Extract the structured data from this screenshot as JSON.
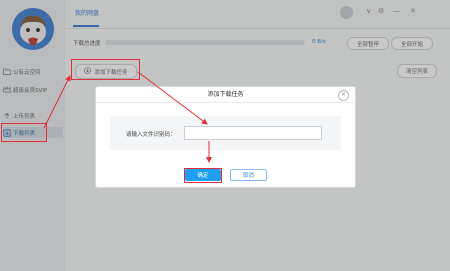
{
  "sidebar": {
    "items": [
      {
        "label": "公有云空间"
      },
      {
        "label": "超级会员SVIP"
      },
      {
        "label": "上传列表"
      },
      {
        "label": "下载列表"
      }
    ]
  },
  "header": {
    "tab": "我的网盘",
    "window_controls": [
      "∨",
      "⚙",
      "—",
      "✕"
    ]
  },
  "progress": {
    "label": "下载总进度",
    "percent_text": "0 B/s",
    "value": 0,
    "pause_all": "全部暂停",
    "start_all": "全部开始"
  },
  "toolbar": {
    "add_task": "添加下载任务",
    "clear_list": "清空列表"
  },
  "dialog": {
    "title": "添加下载任务",
    "label": "请输入文件识别码：",
    "input_value": "",
    "confirm": "确定",
    "cancel": "取消"
  },
  "colors": {
    "accent": "#1e9ff2",
    "highlight": "#e0303a"
  }
}
